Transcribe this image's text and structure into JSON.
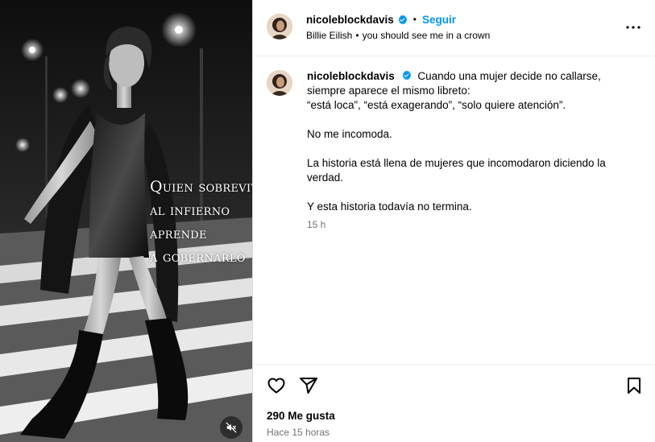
{
  "media": {
    "overlay_lines": [
      "Quien sobrevive",
      "al infierno",
      "aprende",
      "a gobernarlo"
    ],
    "mute_icon": "speaker-muted-icon"
  },
  "header": {
    "username": "nicoleblockdavis",
    "verified_icon": "verified-badge-icon",
    "separator": "•",
    "follow_label": "Seguir",
    "music_artist": "Billie Eilish",
    "music_separator": "•",
    "music_track": "you should see me in a crown",
    "more_icon": "more-options-icon"
  },
  "caption": {
    "username": "nicoleblockdavis",
    "first_line": "Cuando una mujer decide no callarse, siempre aparece el mismo libreto:",
    "quote_line": "“está loca”, “está exagerando”, “solo quiere atención”.",
    "para2": "No me incomoda.",
    "para3": "La historia está llena de mujeres que incomodaron diciendo la verdad.",
    "para4": "Y esta historia todavía no termina.",
    "time": "15 h"
  },
  "actions": {
    "like_icon": "heart-icon",
    "share_icon": "share-icon",
    "save_icon": "bookmark-icon",
    "likes_text": "290 Me gusta",
    "time_ago": "Hace 15 horas"
  },
  "colors": {
    "accent": "#0095f6",
    "verified": "#0095f6",
    "muted_text": "#737373"
  }
}
